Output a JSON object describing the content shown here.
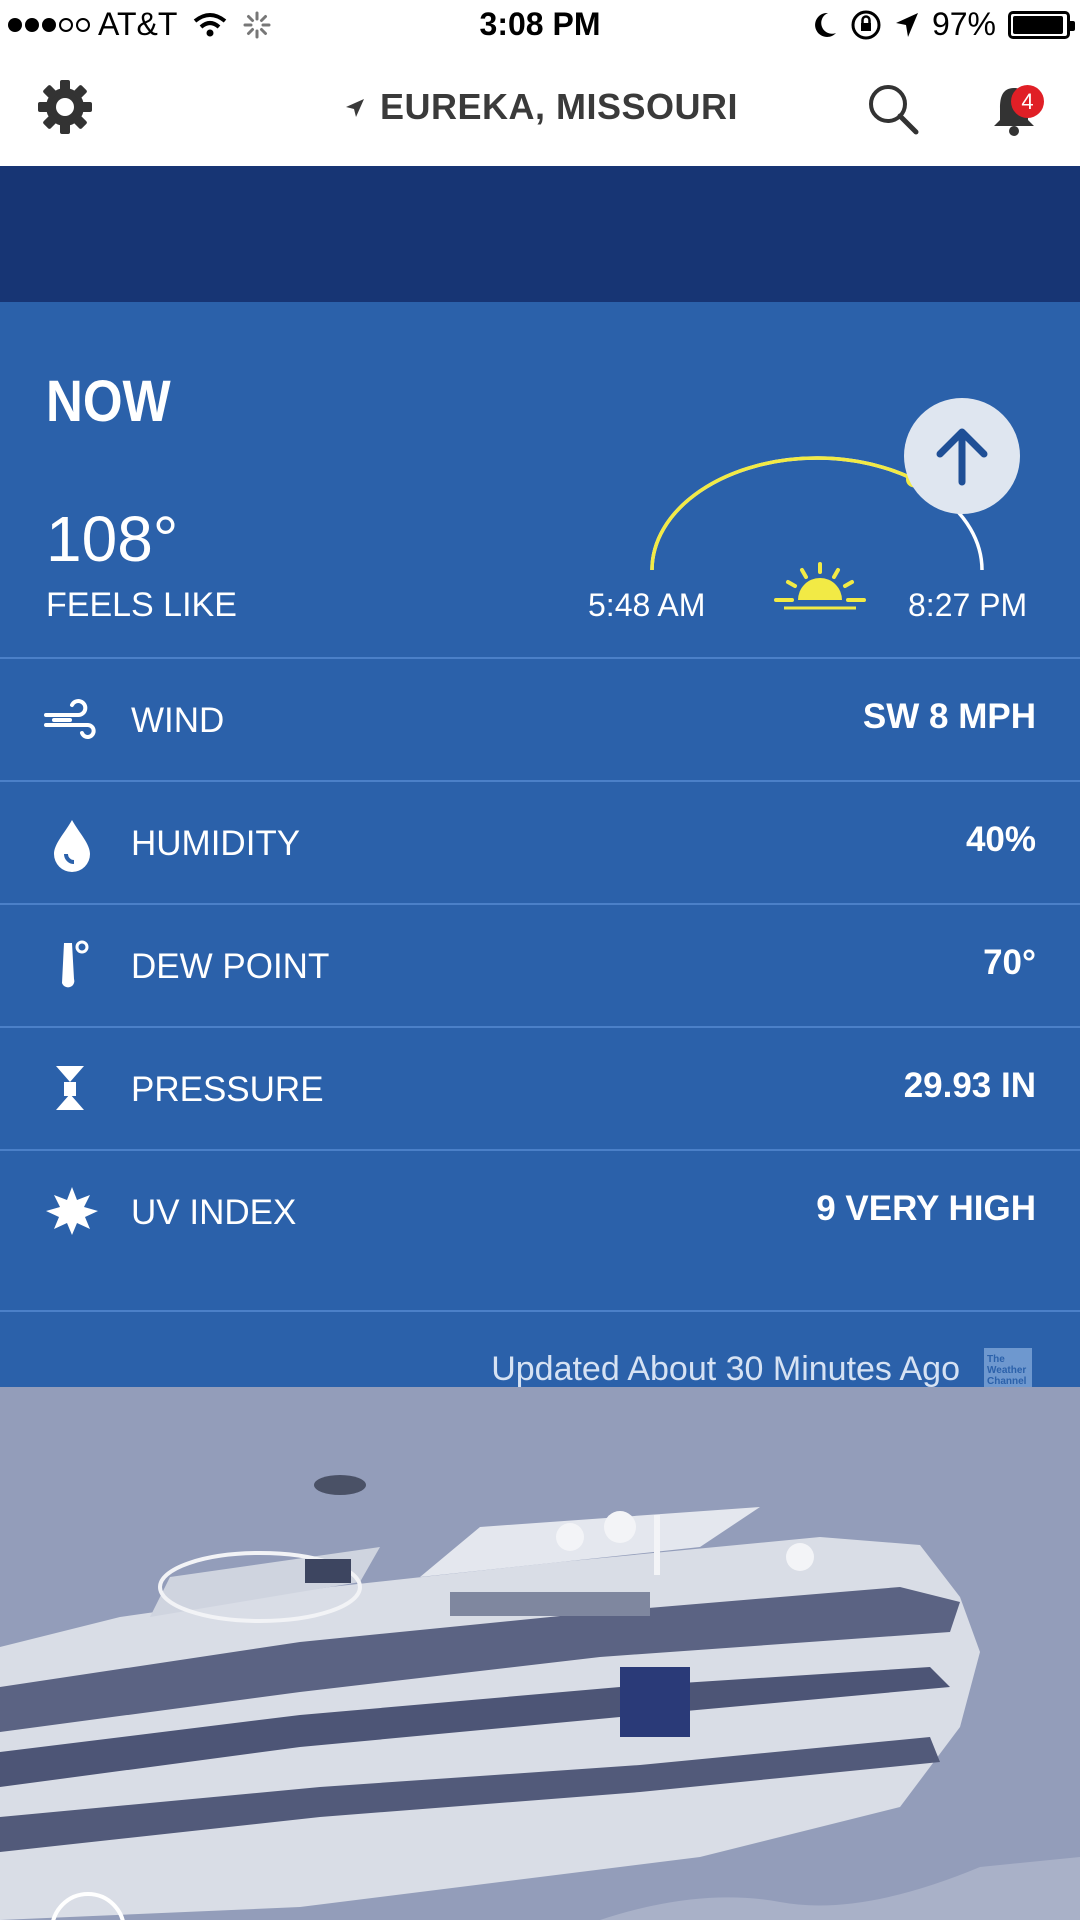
{
  "status_bar": {
    "carrier": "AT&T",
    "time": "3:08 PM",
    "battery": "97%",
    "battery_level": 0.97
  },
  "header": {
    "location": "EUREKA, MISSOURI",
    "notification_count": "4"
  },
  "now": {
    "title": "NOW",
    "temperature": "108°",
    "feels_like_label": "FEELS LIKE",
    "sunrise": "5:48 AM",
    "sunset": "8:27 PM",
    "sun_progress": 0.7
  },
  "rows": [
    {
      "icon": "wind-icon",
      "label": "WIND",
      "value": "SW 8 MPH"
    },
    {
      "icon": "humidity-icon",
      "label": "HUMIDITY",
      "value": "40%"
    },
    {
      "icon": "thermometer-icon",
      "label": "DEW POINT",
      "value": "70°"
    },
    {
      "icon": "pressure-icon",
      "label": "PRESSURE",
      "value": "29.93 IN"
    },
    {
      "icon": "uv-icon",
      "label": "UV INDEX",
      "value": "9 VERY HIGH"
    }
  ],
  "footer": {
    "updated": "Updated About 30 Minutes Ago",
    "logo_text": "The Weather Channel"
  },
  "colors": {
    "panel_blue": "#2b61aa",
    "band_navy": "#173574",
    "sun_yellow": "#f2ea45",
    "badge_red": "#e01f26"
  }
}
